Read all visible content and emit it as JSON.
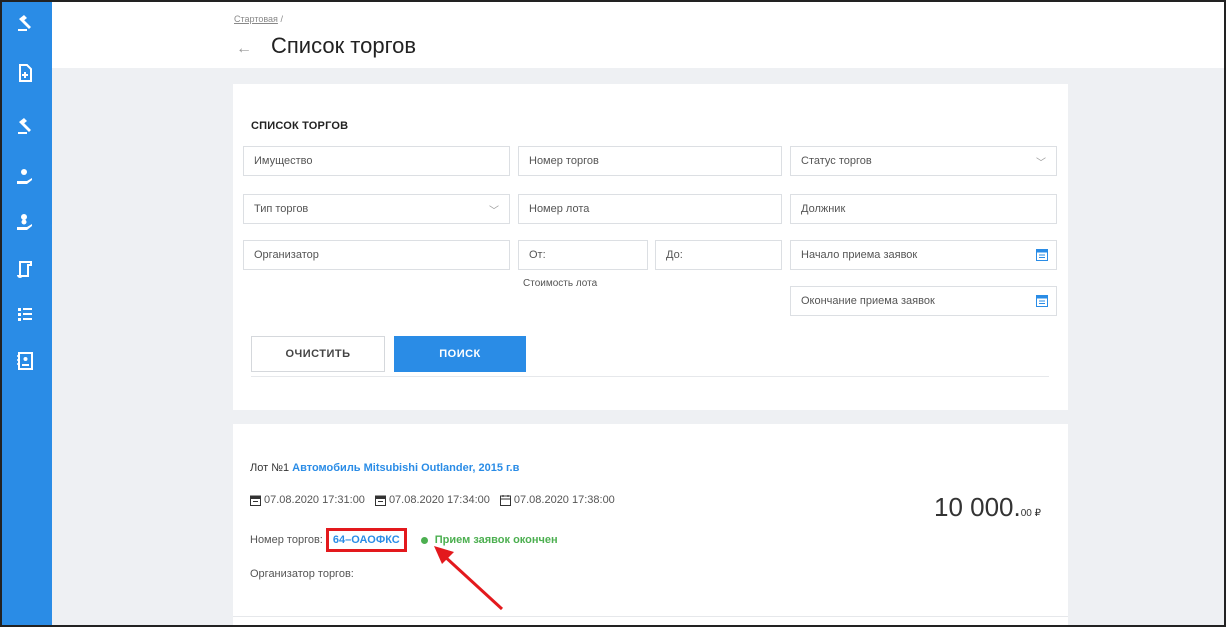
{
  "breadcrumb": {
    "home": "Стартовая",
    "separator": "/"
  },
  "header": {
    "back_icon": "arrow-left-icon",
    "title": "Список торгов"
  },
  "sidebar": {
    "items": [
      {
        "icon": "gavel-icon"
      },
      {
        "icon": "document-icon"
      },
      {
        "icon": "gavel-icon"
      },
      {
        "icon": "hand-coin-icon"
      },
      {
        "icon": "hand-coins-icon"
      },
      {
        "icon": "scroll-icon"
      },
      {
        "icon": "list-icon"
      },
      {
        "icon": "contacts-icon"
      }
    ]
  },
  "filters": {
    "heading": "СПИСОК ТОРГОВ",
    "property": "Имущество",
    "auction_number": "Номер торгов",
    "auction_status": "Статус торгов",
    "auction_type": "Тип торгов",
    "lot_number": "Номер лота",
    "debtor": "Должник",
    "organizer": "Организатор",
    "price_from": "От:",
    "price_to": "До:",
    "price_label": "Стоимость лота",
    "apply_start": "Начало приема заявок",
    "apply_end": "Окончание приема заявок",
    "clear_label": "ОЧИСТИТЬ",
    "search_label": "ПОИСК"
  },
  "lot": {
    "prefix": "Лот №1",
    "title": "Автомобиль Mitsubishi Outlander, 2015 г.в",
    "date_start": "07.08.2020 17:31:00",
    "date_end": "07.08.2020 17:34:00",
    "date_result": "07.08.2020 17:38:00",
    "price_main": "10 000.",
    "price_cents": "00 ₽",
    "auction_label": "Номер торгов:",
    "auction_number": "64–ОАОФКС",
    "status": "Прием заявок окончен",
    "organizer_label": "Организатор торгов:"
  },
  "colors": {
    "accent": "#2a8ce6",
    "highlight": "#e3191d",
    "status": "#4caf50"
  }
}
